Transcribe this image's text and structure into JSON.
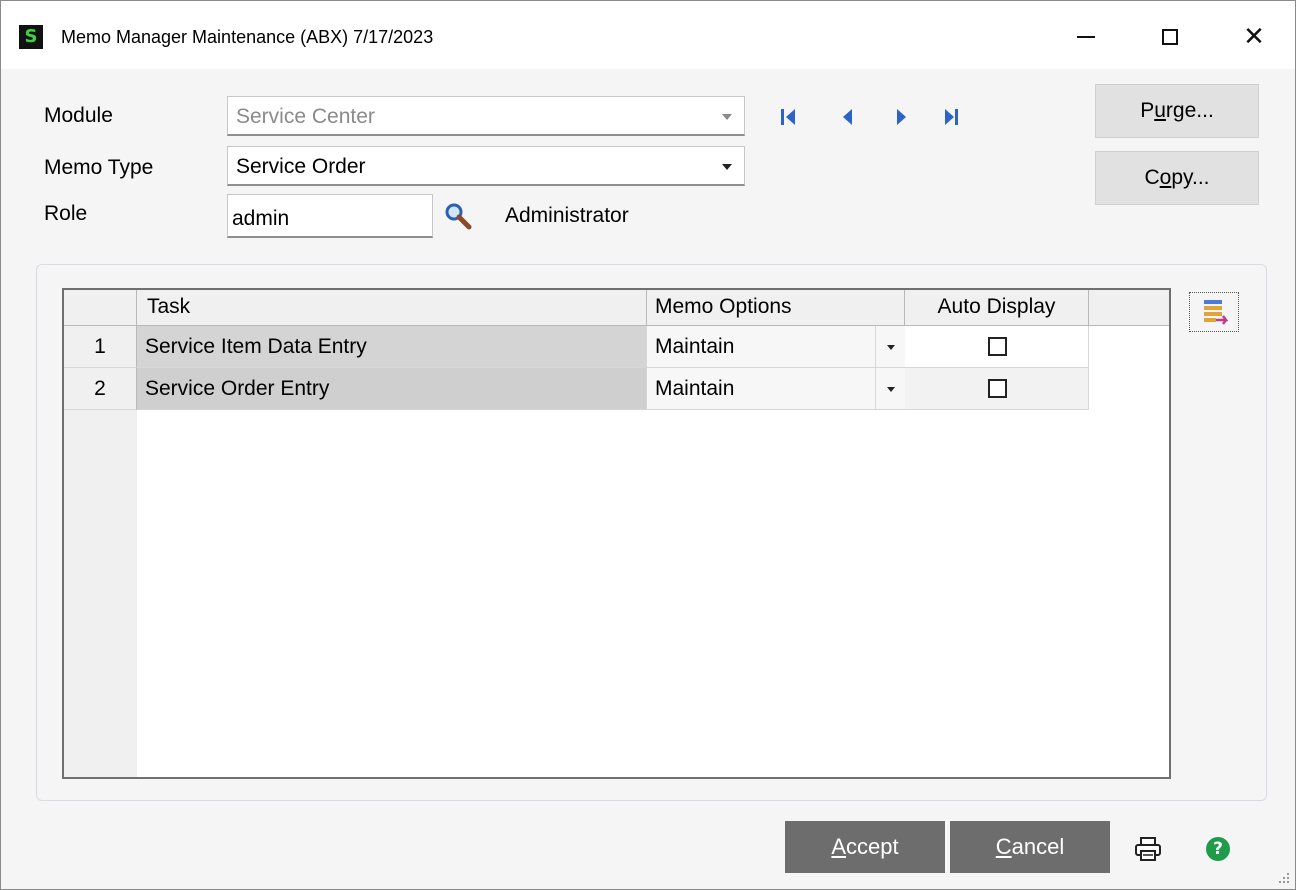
{
  "window": {
    "title": "Memo Manager Maintenance (ABX) 7/17/2023",
    "app_icon_letter": "S",
    "minimize_label": "",
    "maximize_label": "",
    "close_label": "✕"
  },
  "form": {
    "module_label": "Module",
    "module_value": "Service Center",
    "memo_type_label": "Memo Type",
    "memo_type_value": "Service Order",
    "role_label": "Role",
    "role_value": "admin",
    "role_description": "Administrator"
  },
  "navigation": {
    "icons": [
      "first-record-icon",
      "previous-record-icon",
      "next-record-icon",
      "last-record-icon"
    ]
  },
  "side_buttons": {
    "purge_pre": "P",
    "purge_underlined": "u",
    "purge_post": "rge...",
    "copy_pre": "C",
    "copy_underlined": "o",
    "copy_post": "py..."
  },
  "grid": {
    "columns": [
      "Task",
      "Memo Options",
      "Auto Display"
    ],
    "rows": [
      {
        "num": "1",
        "task": "Service Item Data Entry",
        "memo_option": "Maintain",
        "auto_display": false
      },
      {
        "num": "2",
        "task": "Service Order Entry",
        "memo_option": "Maintain",
        "auto_display": false
      }
    ]
  },
  "footer": {
    "accept_underlined": "A",
    "accept_post": "ccept",
    "cancel_underlined": "C",
    "cancel_post": "ancel",
    "help_glyph": "?"
  },
  "colors": {
    "nav_blue": "#2c63c9",
    "button_dark": "#6d6d6d",
    "help_green": "#1e9c4a"
  }
}
